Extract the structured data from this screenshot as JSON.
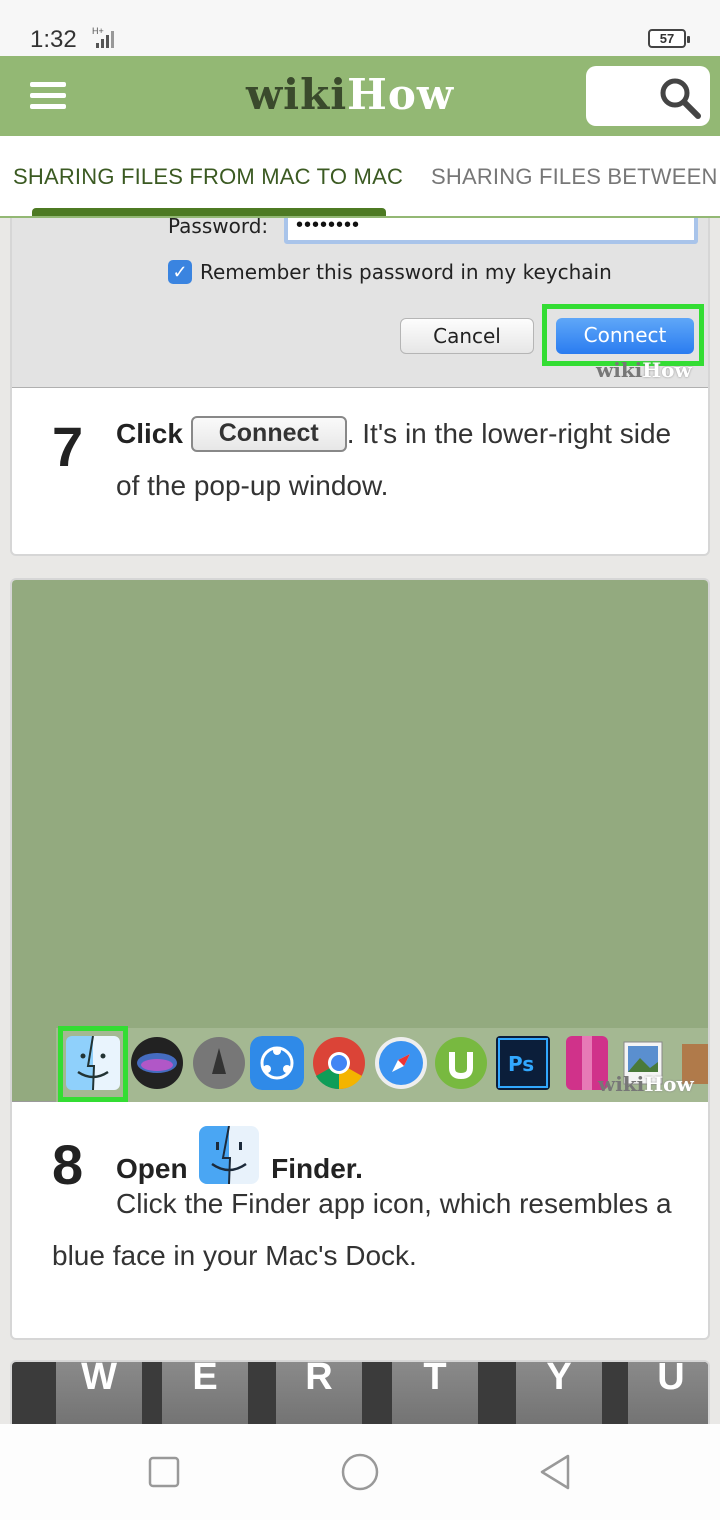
{
  "status": {
    "time": "1:32",
    "network": "H+",
    "battery": "57"
  },
  "header": {
    "logo_wiki": "wiki",
    "logo_how": "How"
  },
  "tabs": [
    {
      "label": "SHARING FILES FROM MAC TO MAC",
      "active": true
    },
    {
      "label": "SHARING FILES BETWEEN",
      "active": false
    }
  ],
  "step7": {
    "image": {
      "password_label": "Password:",
      "password_value": "••••••••",
      "remember_label": "Remember this password in my keychain",
      "cancel_label": "Cancel",
      "connect_label": "Connect",
      "watermark_wiki": "wiki",
      "watermark_how": "How"
    },
    "number": "7",
    "lead": "Click",
    "button_label": "Connect",
    "text": ". It's in the lower-right side of the pop-up window."
  },
  "step8": {
    "image": {
      "watermark_wiki": "wiki",
      "watermark_how": "How",
      "dock_icons": [
        "finder-icon",
        "siri-icon",
        "launchpad-icon",
        "shareit-icon",
        "chrome-icon",
        "safari-icon",
        "utorrent-icon",
        "photoshop-icon",
        "winrar-icon",
        "preview-icon"
      ]
    },
    "number": "8",
    "lead": "Open",
    "app_name": "Finder.",
    "text": "Click the Finder app icon, which resembles a blue face in your Mac's Dock."
  },
  "step9": {
    "keys": [
      "W",
      "E",
      "R",
      "T",
      "Y",
      "U"
    ]
  },
  "colors": {
    "header_green": "#93b874",
    "tab_active": "#3b5a22",
    "highlight_green": "#33dd33"
  }
}
